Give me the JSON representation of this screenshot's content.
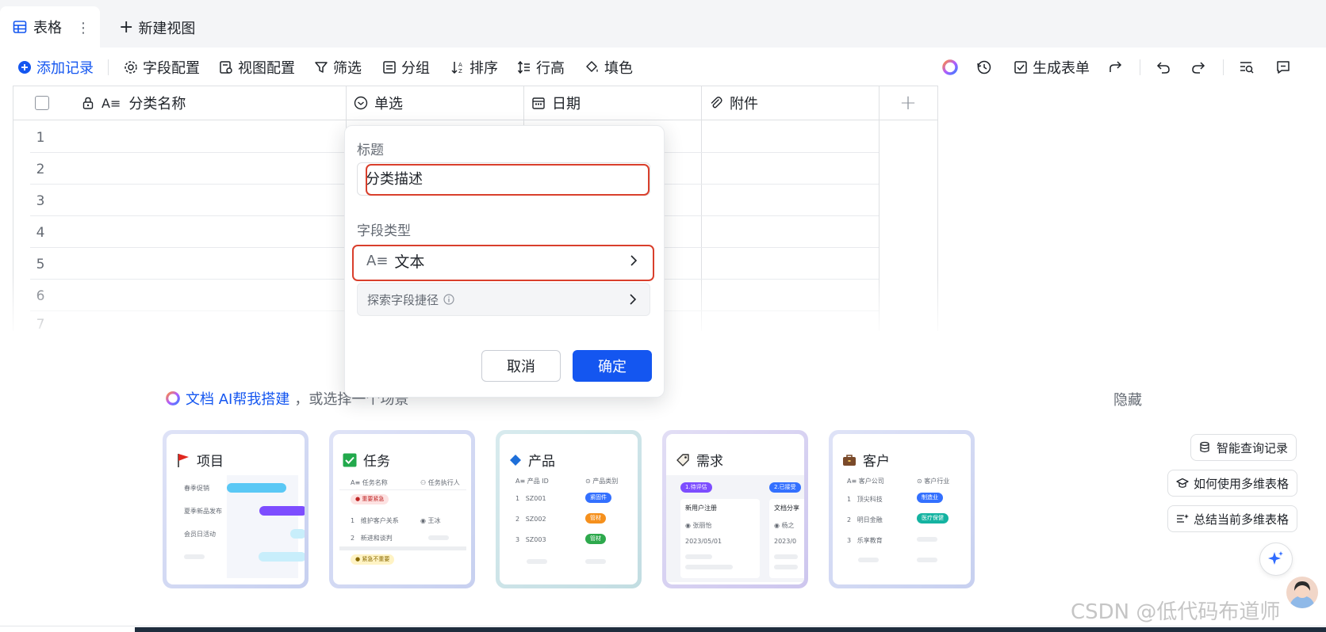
{
  "tabs": {
    "active_label": "表格",
    "new_view_label": "新建视图"
  },
  "toolbar": {
    "add_record": "添加记录",
    "field_config": "字段配置",
    "view_config": "视图配置",
    "filter": "筛选",
    "group": "分组",
    "sort": "排序",
    "row_height": "行高",
    "fill_color": "填色",
    "generate_form": "生成表单"
  },
  "table": {
    "columns": [
      "分类名称",
      "单选",
      "日期",
      "附件"
    ],
    "row_numbers": [
      "1",
      "2",
      "3",
      "4",
      "5",
      "6",
      "7"
    ]
  },
  "field_popup": {
    "title_label": "标题",
    "title_value": "分类描述",
    "type_label": "字段类型",
    "type_value": "文本",
    "explore_label": "探索字段捷径",
    "cancel_label": "取消",
    "confirm_label": "确定"
  },
  "ai_prompt": {
    "ai_link": "文档 AI帮我搭建",
    "suffix": "，或选择一个场景",
    "hide_label": "隐藏"
  },
  "scenario_cards": [
    {
      "title": "项目",
      "rows": [
        "春季促销",
        "夏季新品发布",
        "会员日活动"
      ]
    },
    {
      "title": "任务",
      "col1": "任务名称",
      "col2": "任务执行人",
      "tag_top": "重要紧急",
      "rows": [
        "维护客户关系",
        "新进和谈判"
      ],
      "person": "王冰",
      "tag_bottom": "紧急不重要"
    },
    {
      "title": "产品",
      "col1": "产品 ID",
      "col2": "产品类别",
      "rows": [
        "SZ001",
        "SZ002",
        "SZ003"
      ],
      "tags": [
        "紧固件",
        "管材",
        "管材"
      ]
    },
    {
      "title": "需求",
      "stage1": "1.待评估",
      "stage2": "2.已接受",
      "item1": "新用户注册",
      "item2": "文档分享",
      "person1": "张丽怡",
      "person2": "杨之",
      "date1": "2023/05/01",
      "date2": "2023/0"
    },
    {
      "title": "客户",
      "col1": "客户公司",
      "col2": "客户行业",
      "rows": [
        "顶尖科技",
        "明日金融",
        "乐享教育"
      ],
      "tags": [
        "制造业",
        "医疗保健"
      ]
    }
  ],
  "assistant": {
    "items": [
      "智能查询记录",
      "如何使用多维表格",
      "总结当前多维表格"
    ]
  },
  "watermark": "CSDN @低代码布道师",
  "colors": {
    "accent": "#1456f0",
    "highlight_box": "#d93f2c"
  }
}
